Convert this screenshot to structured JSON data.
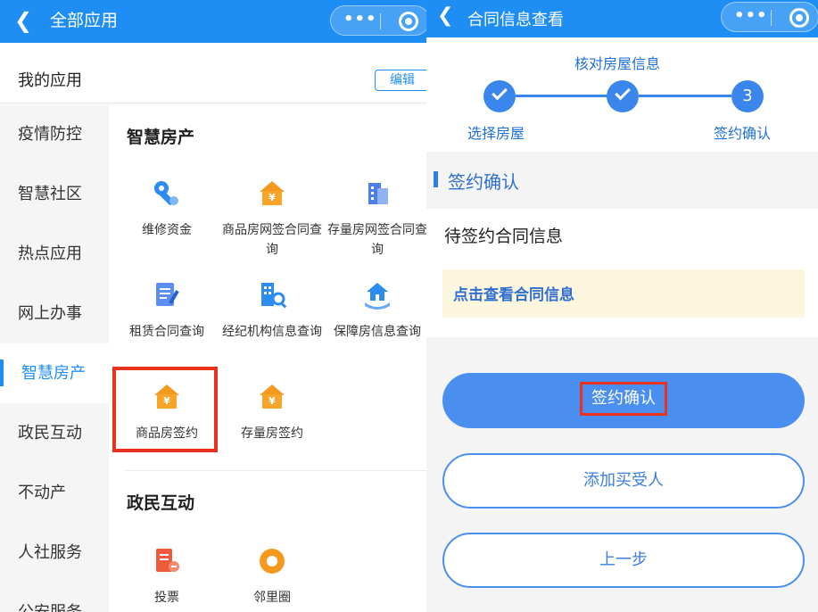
{
  "left": {
    "header": {
      "back_icon": "chevron-left-icon",
      "title": "全部应用"
    },
    "my_apps": {
      "title": "我的应用",
      "edit_label": "编辑"
    },
    "sidebar": {
      "items": [
        {
          "label": "疫情防控"
        },
        {
          "label": "智慧社区"
        },
        {
          "label": "热点应用"
        },
        {
          "label": "网上办事"
        },
        {
          "label": "智慧房产",
          "active": true
        },
        {
          "label": "政民互动"
        },
        {
          "label": "不动产"
        },
        {
          "label": "人社服务"
        },
        {
          "label": "公安服务"
        }
      ]
    },
    "sections": [
      {
        "title": "智慧房产",
        "apps": [
          {
            "label": "维修资金",
            "icon": "wrench-icon"
          },
          {
            "label": "商品房网签合同查询",
            "icon": "house-yen-icon"
          },
          {
            "label": "存量房网签合同查询",
            "icon": "building-document-icon"
          },
          {
            "label": "租赁合同查询",
            "icon": "document-edit-icon"
          },
          {
            "label": "经纪机构信息查询",
            "icon": "building-search-icon"
          },
          {
            "label": "保障房信息查询",
            "icon": "house-hand-icon"
          },
          {
            "label": "商品房签约",
            "icon": "house-yen-icon",
            "highlighted": true
          },
          {
            "label": "存量房签约",
            "icon": "house-yen-icon"
          }
        ]
      },
      {
        "title": "政民互动",
        "apps": [
          {
            "label": "投票",
            "icon": "vote-icon"
          },
          {
            "label": "邻里圈",
            "icon": "neighborhood-circle-icon"
          }
        ]
      }
    ]
  },
  "right": {
    "header": {
      "back_icon": "chevron-left-icon",
      "title": "合同信息查看"
    },
    "steps": {
      "top_label": "核对房屋信息",
      "items": [
        {
          "label": "选择房屋",
          "state": "done"
        },
        {
          "label": "核对房屋信息",
          "state": "done"
        },
        {
          "label": "签约确认",
          "state": "current",
          "number": "3"
        }
      ]
    },
    "section_title": "签约确认",
    "card": {
      "title": "待签约合同信息",
      "link": "点击查看合同信息"
    },
    "buttons": {
      "confirm": "签约确认",
      "add_buyer": "添加买受人",
      "prev": "上一步"
    }
  },
  "colors": {
    "primary": "#1f8ef4",
    "button": "#4a8ef0",
    "highlight": "#e8321e",
    "house_icon": "#f39a1e",
    "link_bg": "#fdf6de"
  }
}
